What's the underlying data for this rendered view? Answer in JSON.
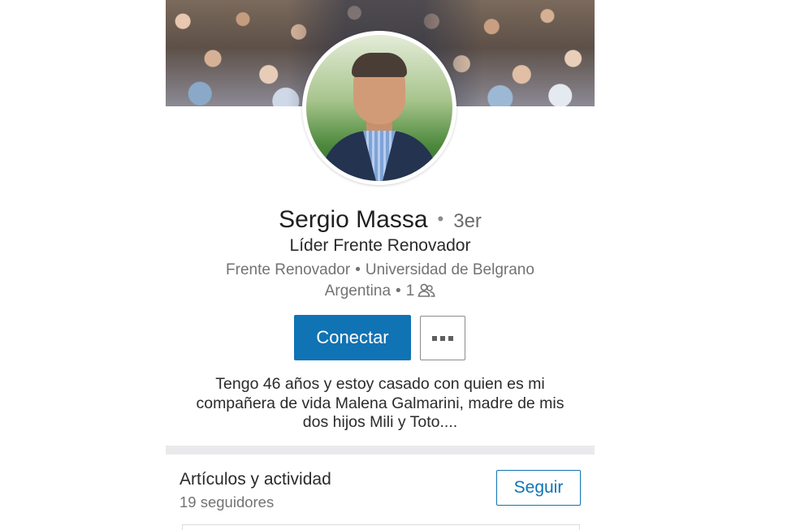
{
  "profile": {
    "name": "Sergio Massa",
    "degree": "3er",
    "headline": "Líder Frente Renovador",
    "company": "Frente Renovador",
    "school": "Universidad de Belgrano",
    "location": "Argentina",
    "connections": "1",
    "summary": "Tengo 46 años y estoy casado con quien es mi compañera de vida Malena Galmarini, madre de mis dos hijos Mili y Toto...."
  },
  "actions": {
    "connect_label": "Conectar",
    "more_icon": "more-horizontal-icon"
  },
  "activity": {
    "title": "Artículos y actividad",
    "followers": "19 seguidores",
    "follow_label": "Seguir"
  },
  "colors": {
    "accent": "#1073b4",
    "muted_text": "#737373",
    "divider": "#e9eaec"
  },
  "icons": {
    "connections": "people-icon"
  }
}
